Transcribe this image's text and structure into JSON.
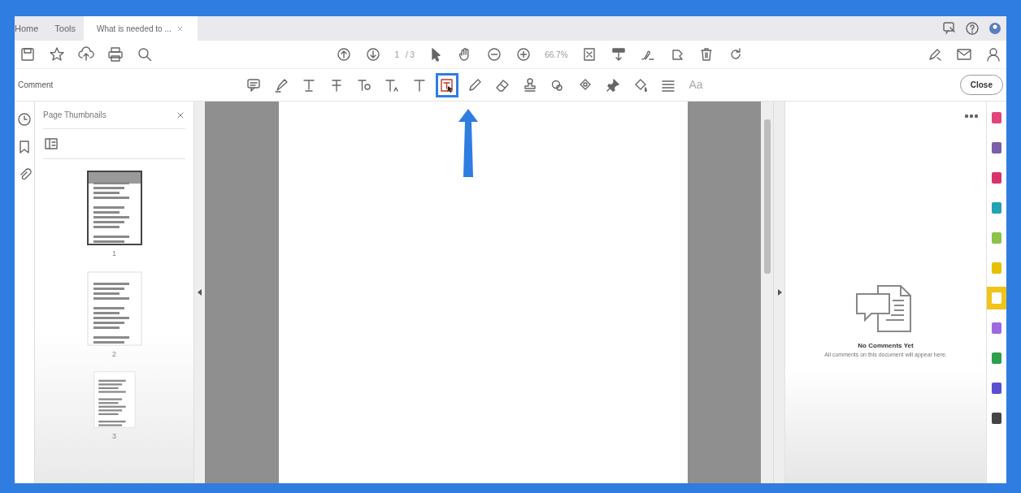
{
  "tabs": [
    {
      "label": "Home",
      "kind": "menu",
      "selected": false
    },
    {
      "label": "Tools",
      "kind": "menu",
      "selected": false
    },
    {
      "label": "What is needed to ...",
      "kind": "document",
      "selected": true
    }
  ],
  "toolbar": {
    "page_number": "1",
    "page_total": "/ 3",
    "zoom": "66.7%"
  },
  "comment_toolbar": {
    "title": "Comment",
    "tools": [
      {
        "kind": "note",
        "selected": false
      },
      {
        "kind": "highlight",
        "selected": false
      },
      {
        "kind": "text-underline",
        "selected": false
      },
      {
        "kind": "text-strike",
        "selected": false
      },
      {
        "kind": "text-replace",
        "selected": false
      },
      {
        "kind": "text-insert",
        "selected": false
      },
      {
        "kind": "text-plain",
        "selected": false
      },
      {
        "kind": "textbox",
        "selected": true
      },
      {
        "kind": "pencil",
        "selected": false
      },
      {
        "kind": "eraser",
        "selected": false
      },
      {
        "kind": "stamp",
        "selected": false
      },
      {
        "kind": "attach",
        "selected": false
      },
      {
        "kind": "shapes",
        "selected": false
      },
      {
        "kind": "pin",
        "selected": false
      },
      {
        "kind": "fill",
        "selected": false
      },
      {
        "kind": "lines",
        "selected": false
      },
      {
        "kind": "font",
        "label": "Aa",
        "selected": false
      }
    ],
    "close_button": "Close"
  },
  "thumbnails_panel": {
    "title": "Page Thumbnails",
    "pages": [
      {
        "label": "1",
        "selected": true
      },
      {
        "label": "2",
        "selected": false
      },
      {
        "label": "3",
        "selected": false
      }
    ]
  },
  "comments_panel": {
    "heading": "No Comments Yet",
    "message": "All comments on this document will appear here."
  },
  "tool_strip": [
    {
      "color": "#e0457b",
      "selected": false
    },
    {
      "color": "#7b5ea7",
      "selected": false
    },
    {
      "color": "#d6336c",
      "selected": false
    },
    {
      "color": "#1fa3b5",
      "selected": false
    },
    {
      "color": "#8bc34a",
      "selected": false
    },
    {
      "color": "#e5c100",
      "selected": false
    },
    {
      "color": "#ffffff",
      "selected": true
    },
    {
      "color": "#9c6ade",
      "selected": false
    },
    {
      "color": "#2e9e4f",
      "selected": false
    },
    {
      "color": "#5a4fcf",
      "selected": false
    },
    {
      "color": "#444444",
      "selected": false
    }
  ]
}
